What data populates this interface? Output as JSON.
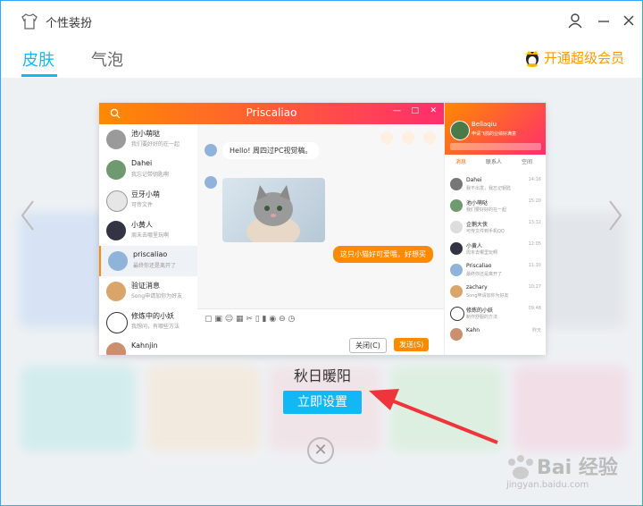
{
  "window": {
    "title": "个性装扮"
  },
  "tabs": [
    {
      "label": "皮肤",
      "active": true
    },
    {
      "label": "气泡",
      "active": false
    }
  ],
  "vip": {
    "label": "开通超级会员"
  },
  "preview": {
    "chat_title": "Priscaliao",
    "contacts": [
      {
        "name": "池小萌哒",
        "msg": "我们要好好的在一起"
      },
      {
        "name": "Dahei",
        "msg": "我忘记带钥匙啊"
      },
      {
        "name": "豆牙小萌",
        "msg": "可传文件"
      },
      {
        "name": "小黄人",
        "msg": "周末去哪里玩啊"
      },
      {
        "name": "priscaliao",
        "msg": "最终你还是离开了"
      },
      {
        "name": "验证消息",
        "msg": "Song申请加你为好友"
      },
      {
        "name": "修炼中的小妖",
        "msg": "我想问，有哪些方法"
      },
      {
        "name": "Kahnjin",
        "msg": ""
      }
    ],
    "bubble_in": "Hello! 周四过PC视觉稿。",
    "bubble_out": "这只小猫好可爱哦，好想买",
    "close_btn": "关闭(C)",
    "send_btn": "发送(S)",
    "right_panel": {
      "user": "Bellaqiu",
      "signature": "申请飞鸽的业绩好满意",
      "tabs": [
        "消息",
        "联系人",
        "空间"
      ],
      "items": [
        {
          "name": "Dahei",
          "msg": "我不出发，我忘记钥匙",
          "time": "14:16"
        },
        {
          "name": "池小萌哒",
          "msg": "我们要好好的在一起",
          "time": "15:20"
        },
        {
          "name": "企鹅大侠",
          "msg": "可传文件到手机QQ",
          "time": "13:32"
        },
        {
          "name": "小黄人",
          "msg": "周末去哪里玩啊",
          "time": "12:05"
        },
        {
          "name": "Priscaliao",
          "msg": "最终你还是离开了",
          "time": "11:10"
        },
        {
          "name": "zachary",
          "msg": "Song申请加你为好友",
          "time": "10:27"
        },
        {
          "name": "修炼的小妖",
          "msg": "制作舒服的方法",
          "time": "09:48"
        },
        {
          "name": "Kahn",
          "msg": "",
          "time": "昨天"
        }
      ]
    }
  },
  "theme": {
    "name": "秋日暖阳",
    "apply_label": "立即设置"
  },
  "watermark": {
    "text": "Bai 经验",
    "sub": "jingyan.baidu.com"
  },
  "colors": {
    "accent": "#12b7f5",
    "vip": "#ff9a00",
    "theme_gradient_start": "#ff8a00",
    "theme_gradient_end": "#ff2e6d"
  }
}
